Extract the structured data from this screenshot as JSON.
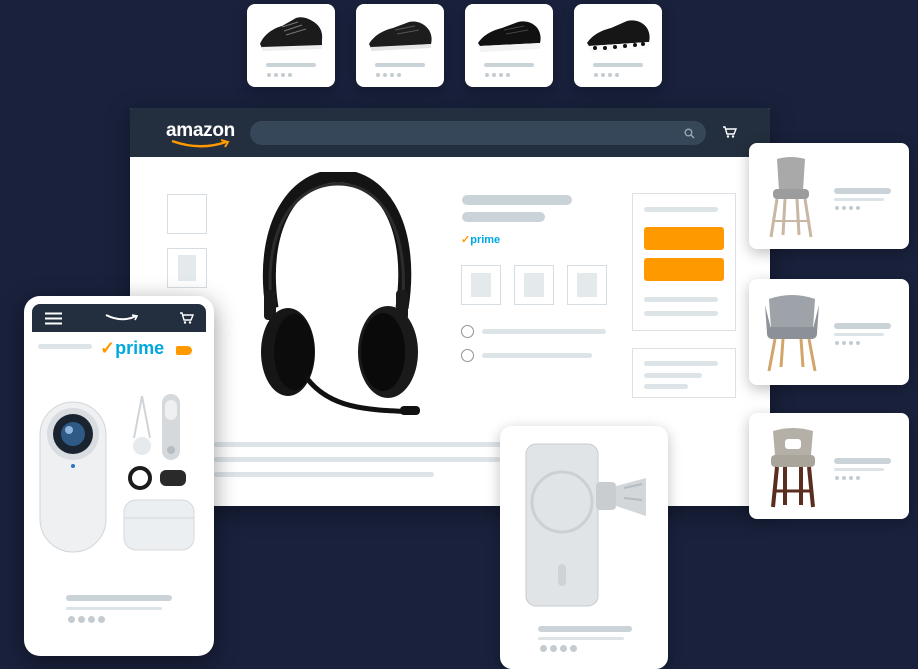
{
  "desktop": {
    "logo_text": "amazon",
    "search_icon": "search-icon",
    "cart_icon": "cart-icon",
    "prime_label": "prime",
    "prime_check": "✓"
  },
  "mobile": {
    "menu_icon": "hamburger-icon",
    "logo_icon": "amazon-smile-logo",
    "cart_icon": "cart-icon",
    "prime_label": "prime",
    "prime_check": "✓"
  },
  "colors": {
    "background": "#19213c",
    "header": "#232f3e",
    "accent": "#ff9900",
    "prime_blue": "#00a8e1"
  },
  "products": {
    "shoes": [
      "sneaker-black-1",
      "sneaker-black-2",
      "sneaker-black-3",
      "sneaker-black-white-pattern"
    ],
    "main": "wireless-headset",
    "mobile": "action-camera-kit",
    "accessory": "magsafe-car-mount",
    "chairs": [
      "bar-stool-gray",
      "accent-chair-gray",
      "bar-stool-brown"
    ]
  }
}
